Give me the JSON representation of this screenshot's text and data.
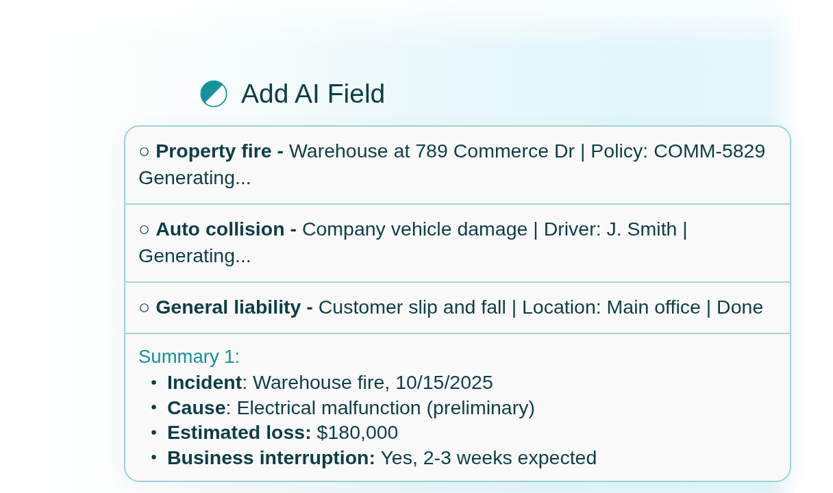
{
  "header": {
    "title": "Add AI Field"
  },
  "claims": [
    {
      "text": "○ **Property fire -** Warehouse at 789 Commerce Dr | Policy: COMM-5829 Generating..."
    },
    {
      "text": "○ **Auto collision -** Company vehicle damage | Driver: J. Smith | Generating..."
    },
    {
      "text": "○ **General liability -** Customer slip and fall | Location: Main office | Done"
    }
  ],
  "summary": {
    "label": "Summary 1:",
    "points": [
      "**Incident**: Warehouse fire, 10/15/2025",
      "**Cause**: Electrical malfunction (preliminary)",
      "**Estimated loss:** $180,000",
      "**Business interruption:** Yes, 2-3 weeks expected"
    ]
  }
}
